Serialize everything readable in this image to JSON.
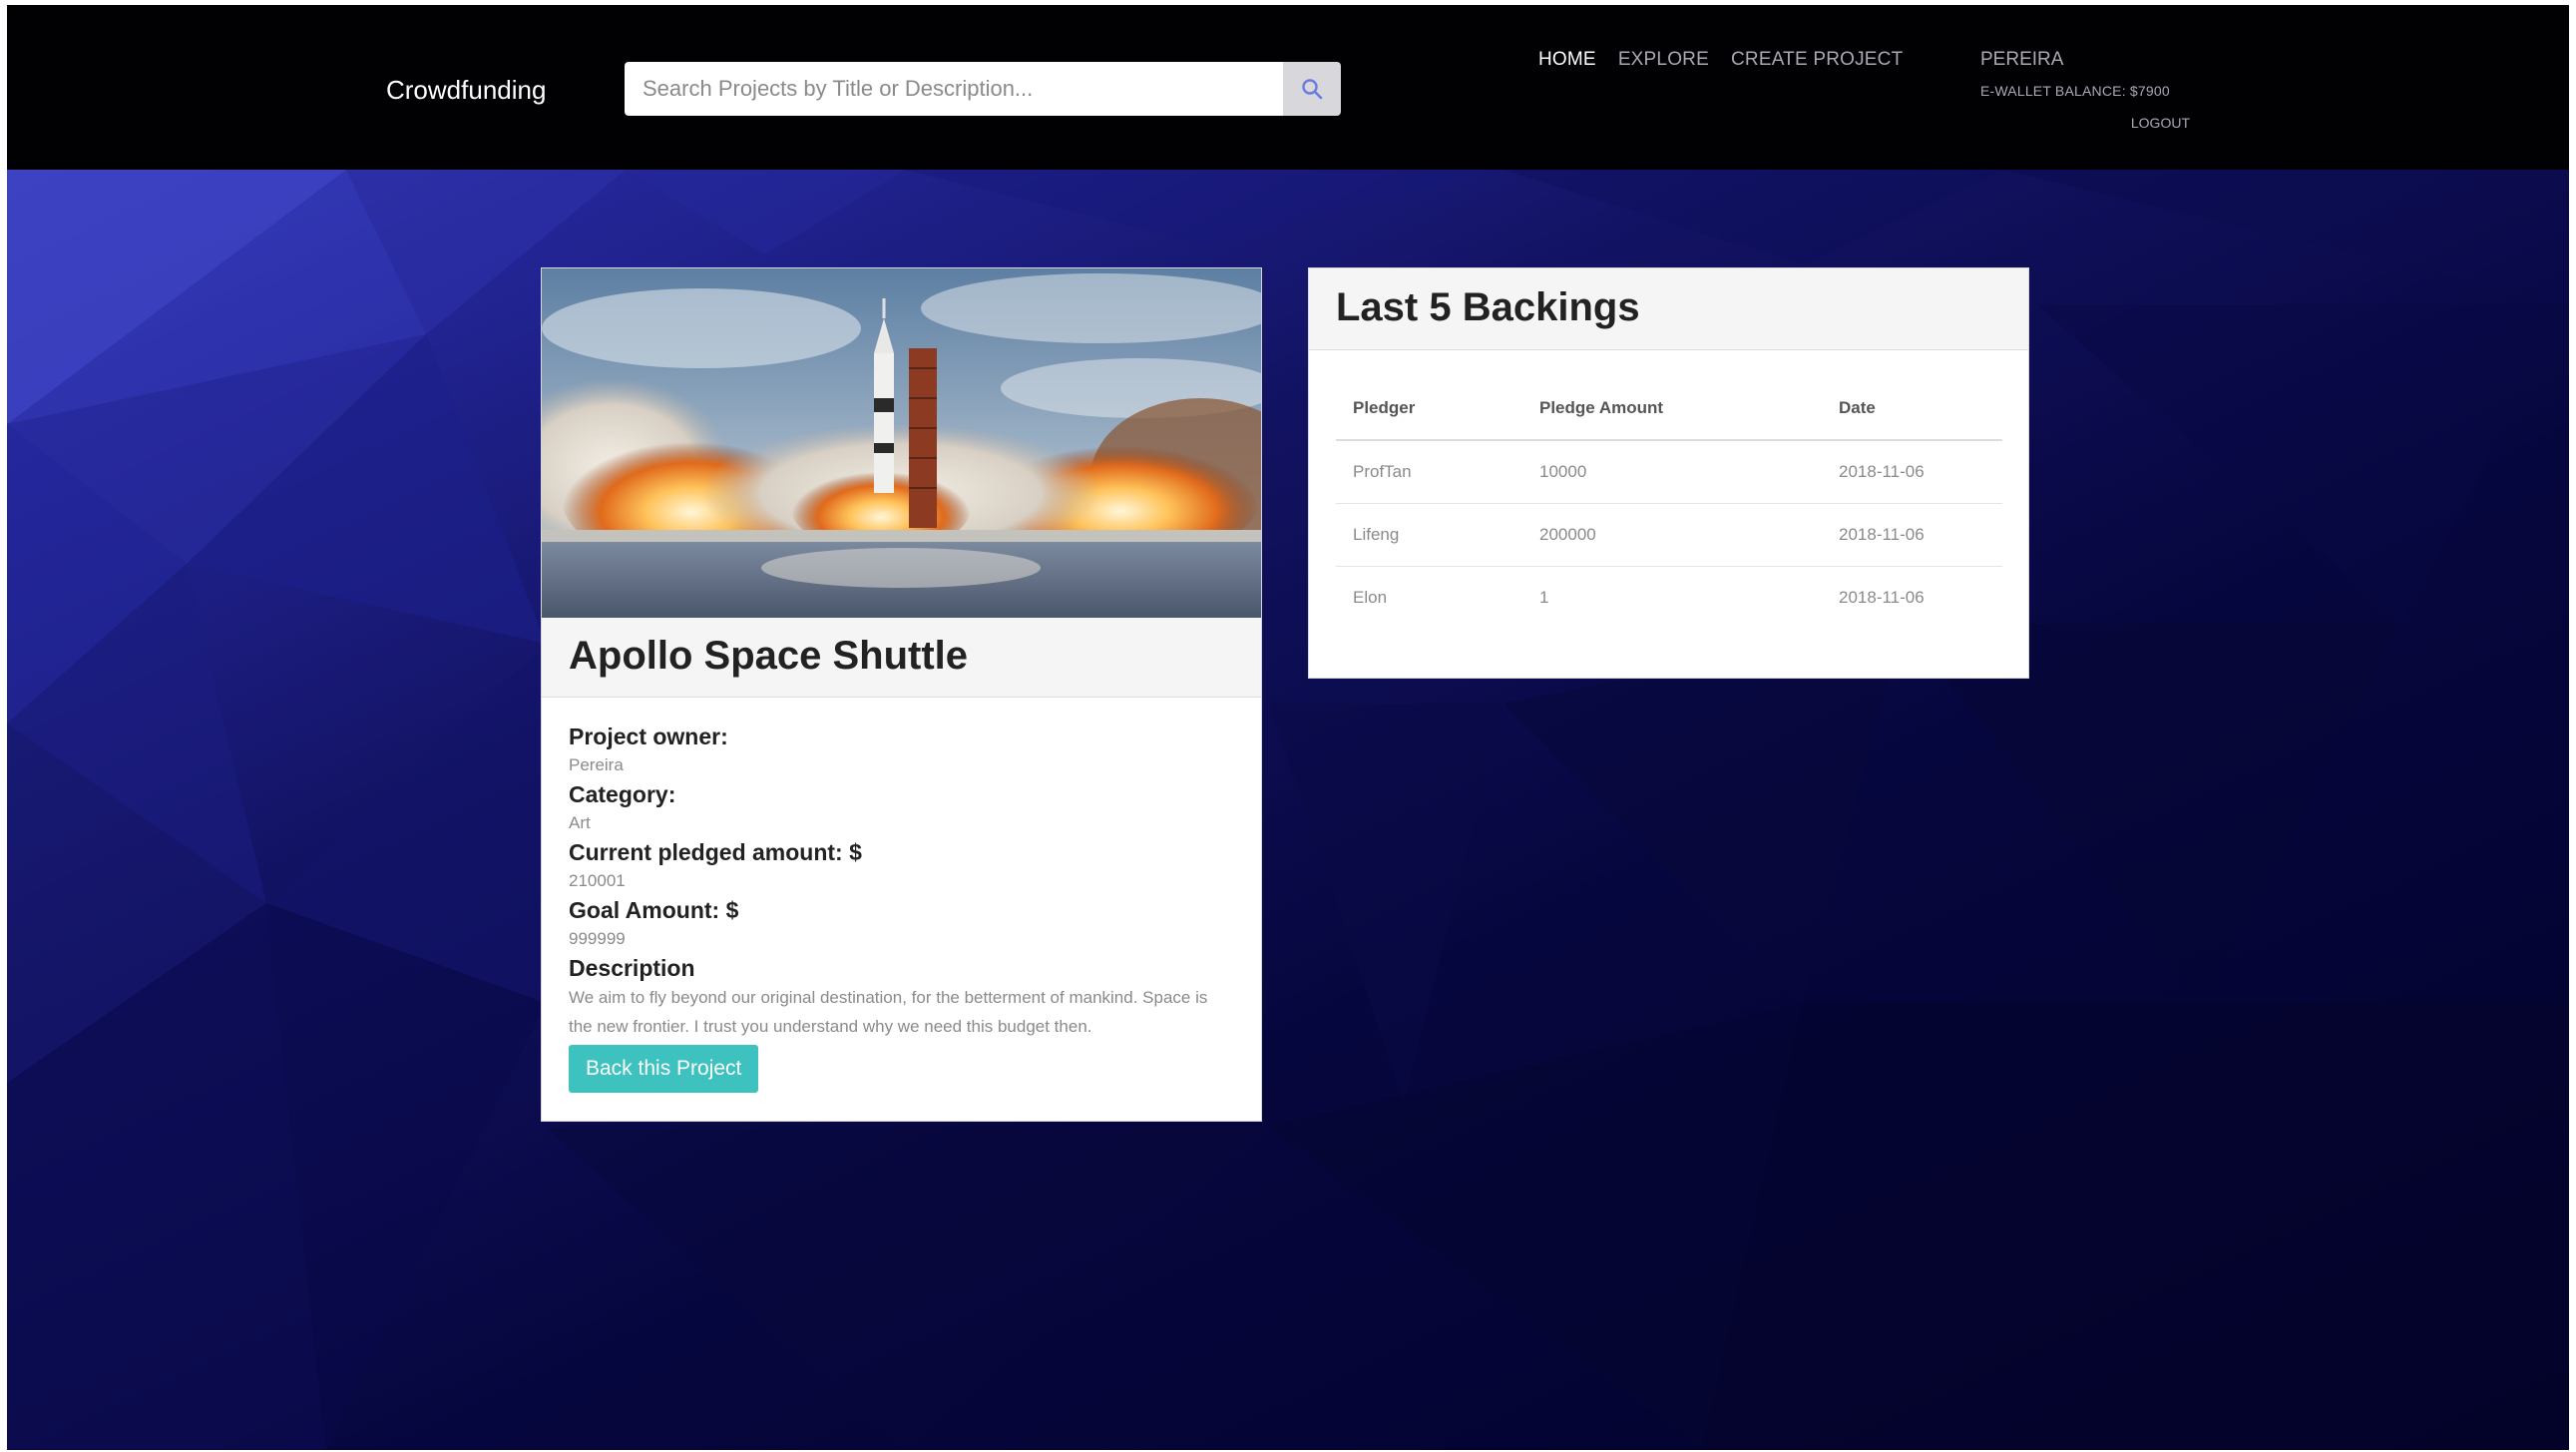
{
  "navbar": {
    "brand": "Crowdfunding",
    "search_placeholder": "Search Projects by Title or Description...",
    "search_icon": "search-icon",
    "links": [
      {
        "label": "HOME",
        "active": true
      },
      {
        "label": "EXPLORE",
        "active": false
      },
      {
        "label": "CREATE PROJECT",
        "active": false
      }
    ],
    "user": {
      "name": "PEREIRA",
      "wallet_balance": "E-WALLET BALANCE: $7900",
      "logout_label": "LOGOUT"
    }
  },
  "project": {
    "image": "rocket-launch-photo",
    "title": "Apollo Space Shuttle",
    "owner_label": "Project owner:",
    "owner": "Pereira",
    "category_label": "Category:",
    "category": "Art",
    "pledged_label": "Current pledged amount: $",
    "pledged": "210001",
    "goal_label": "Goal Amount: $",
    "goal": "999999",
    "description_label": "Description",
    "description": "We aim to fly beyond our original destination, for the betterment of mankind. Space is the new frontier. I trust you understand why we need this budget then.",
    "back_button_label": "Back this Project"
  },
  "backings": {
    "title": "Last 5 Backings",
    "columns": [
      "Pledger",
      "Pledge Amount",
      "Date"
    ],
    "rows": [
      {
        "pledger": "ProfTan",
        "amount": "10000",
        "date": "2018-11-06"
      },
      {
        "pledger": "Lifeng",
        "amount": "200000",
        "date": "2018-11-06"
      },
      {
        "pledger": "Elon",
        "amount": "1",
        "date": "2018-11-06"
      }
    ]
  },
  "colors": {
    "topbar": "#010104",
    "accent_button": "#3ec2c0",
    "background_dark": "#02022a",
    "background_light": "#3a3fc0"
  }
}
